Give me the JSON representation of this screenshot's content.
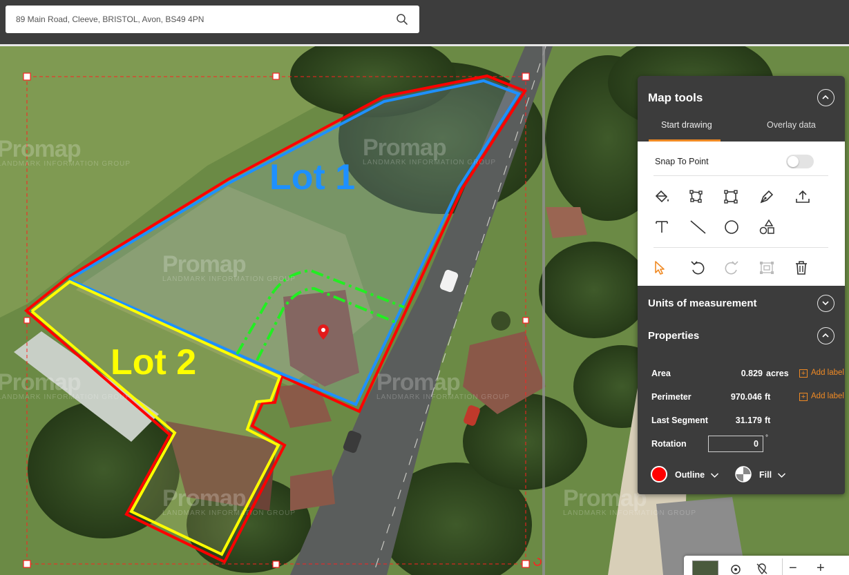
{
  "search": {
    "value": "89 Main Road, Cleeve, BRISTOL, Avon, BS49 4PN"
  },
  "map": {
    "watermark_brand": "Promap",
    "watermark_tagline": "LANDMARK INFORMATION GROUP",
    "lot1_label": "Lot 1",
    "lot2_label": "Lot 2",
    "colors": {
      "outline": "#ff0000",
      "lot1": "#1e90ff",
      "lot2": "#ffff00",
      "path": "#22ee22"
    }
  },
  "panel": {
    "title": "Map tools",
    "tabs": [
      {
        "label": "Start drawing",
        "active": true
      },
      {
        "label": "Overlay data",
        "active": false
      }
    ],
    "snap_to_point": {
      "label": "Snap To Point",
      "on": false
    },
    "tools_row1": [
      "paint-bucket-icon",
      "polygon-icon",
      "rectangle-icon",
      "pen-icon",
      "upload-icon"
    ],
    "tools_row2": [
      "text-icon",
      "line-icon",
      "circle-icon",
      "shapes-icon"
    ],
    "tools_row3": [
      "cursor-icon",
      "undo-icon",
      "redo-icon",
      "select-box-icon",
      "trash-icon"
    ],
    "units_title": "Units of measurement",
    "properties_title": "Properties",
    "area": {
      "label": "Area",
      "value": "0.829",
      "unit": "acres",
      "add": "Add label"
    },
    "perimeter": {
      "label": "Perimeter",
      "value": "970.046",
      "unit": "ft",
      "add": "Add label"
    },
    "last_segment": {
      "label": "Last Segment",
      "value": "31.179",
      "unit": "ft"
    },
    "rotation": {
      "label": "Rotation",
      "value": "0",
      "unit": "°"
    },
    "outline": {
      "label": "Outline",
      "color": "#ff0000"
    },
    "fill": {
      "label": "Fill"
    }
  },
  "controls": {
    "minus": "−",
    "plus": "+"
  }
}
